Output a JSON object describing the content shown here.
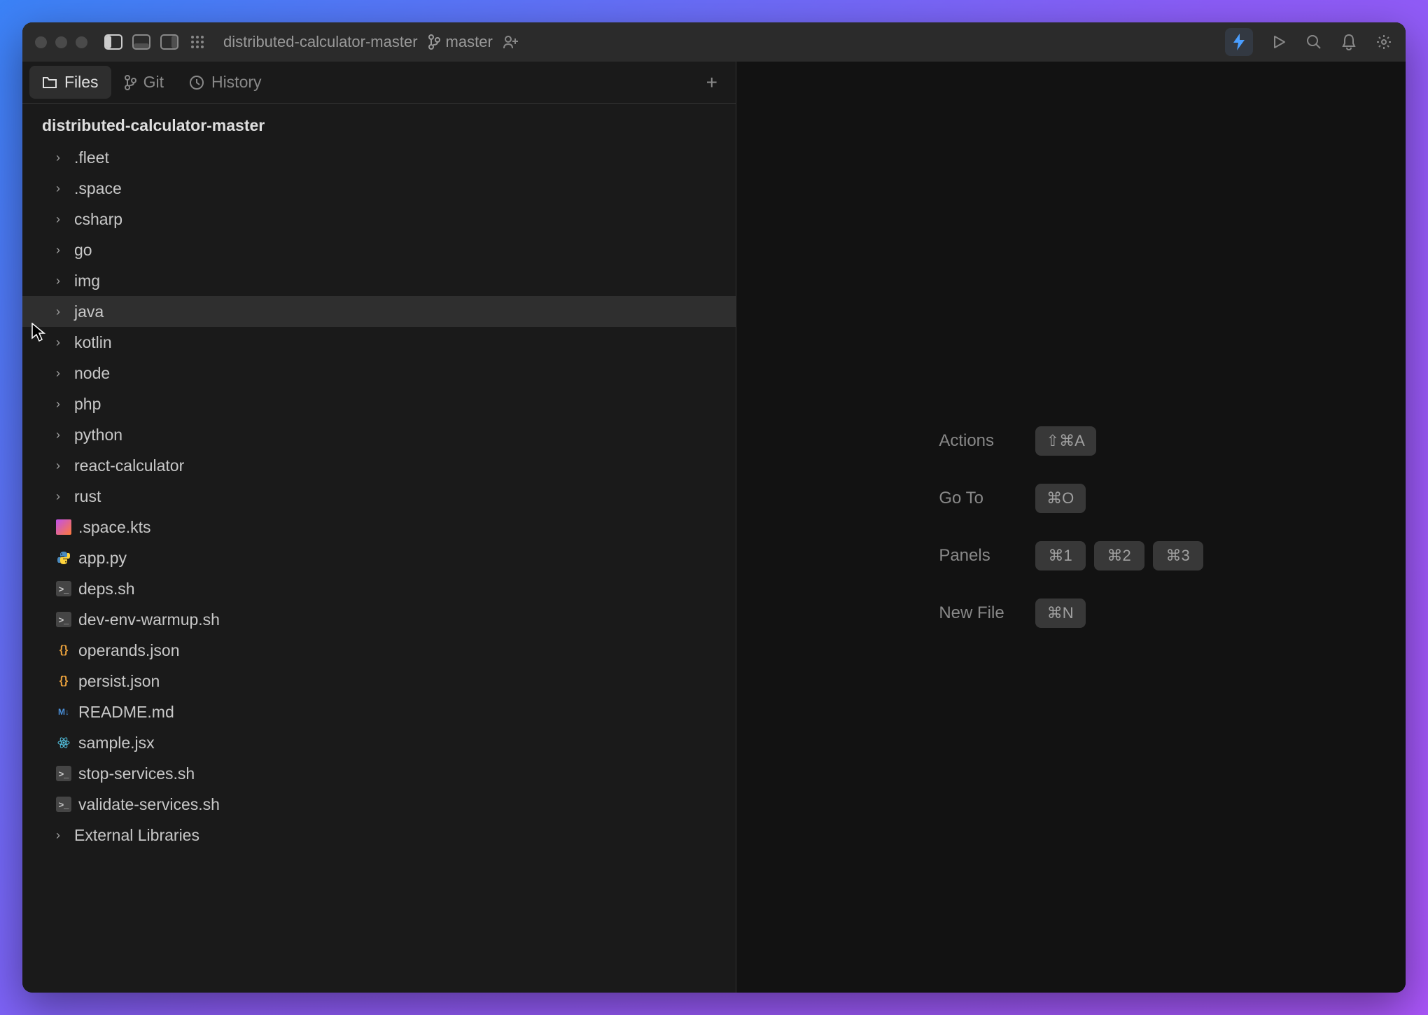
{
  "titlebar": {
    "project": "distributed-calculator-master",
    "branch": "master"
  },
  "sidebar": {
    "tabs": [
      {
        "label": "Files",
        "icon": "folder",
        "active": true
      },
      {
        "label": "Git",
        "icon": "branch",
        "active": false
      },
      {
        "label": "History",
        "icon": "clock",
        "active": false
      }
    ],
    "root": "distributed-calculator-master",
    "items": [
      {
        "type": "folder",
        "name": ".fleet",
        "hover": false
      },
      {
        "type": "folder",
        "name": ".space",
        "hover": false
      },
      {
        "type": "folder",
        "name": "csharp",
        "hover": false
      },
      {
        "type": "folder",
        "name": "go",
        "hover": false
      },
      {
        "type": "folder",
        "name": "img",
        "hover": false
      },
      {
        "type": "folder",
        "name": "java",
        "hover": true
      },
      {
        "type": "folder",
        "name": "kotlin",
        "hover": false
      },
      {
        "type": "folder",
        "name": "node",
        "hover": false
      },
      {
        "type": "folder",
        "name": "php",
        "hover": false
      },
      {
        "type": "folder",
        "name": "python",
        "hover": false
      },
      {
        "type": "folder",
        "name": "react-calculator",
        "hover": false
      },
      {
        "type": "folder",
        "name": "rust",
        "hover": false
      },
      {
        "type": "file",
        "name": ".space.kts",
        "icon": "kotlin"
      },
      {
        "type": "file",
        "name": "app.py",
        "icon": "python"
      },
      {
        "type": "file",
        "name": "deps.sh",
        "icon": "shell"
      },
      {
        "type": "file",
        "name": "dev-env-warmup.sh",
        "icon": "shell"
      },
      {
        "type": "file",
        "name": "operands.json",
        "icon": "json"
      },
      {
        "type": "file",
        "name": "persist.json",
        "icon": "json"
      },
      {
        "type": "file",
        "name": "README.md",
        "icon": "md"
      },
      {
        "type": "file",
        "name": "sample.jsx",
        "icon": "react"
      },
      {
        "type": "file",
        "name": "stop-services.sh",
        "icon": "shell"
      },
      {
        "type": "file",
        "name": "validate-services.sh",
        "icon": "shell"
      },
      {
        "type": "folder",
        "name": "External Libraries",
        "hover": false
      }
    ]
  },
  "shortcuts": [
    {
      "label": "Actions",
      "keys": [
        "⇧⌘A"
      ]
    },
    {
      "label": "Go To",
      "keys": [
        "⌘O"
      ]
    },
    {
      "label": "Panels",
      "keys": [
        "⌘1",
        "⌘2",
        "⌘3"
      ]
    },
    {
      "label": "New File",
      "keys": [
        "⌘N"
      ]
    }
  ]
}
